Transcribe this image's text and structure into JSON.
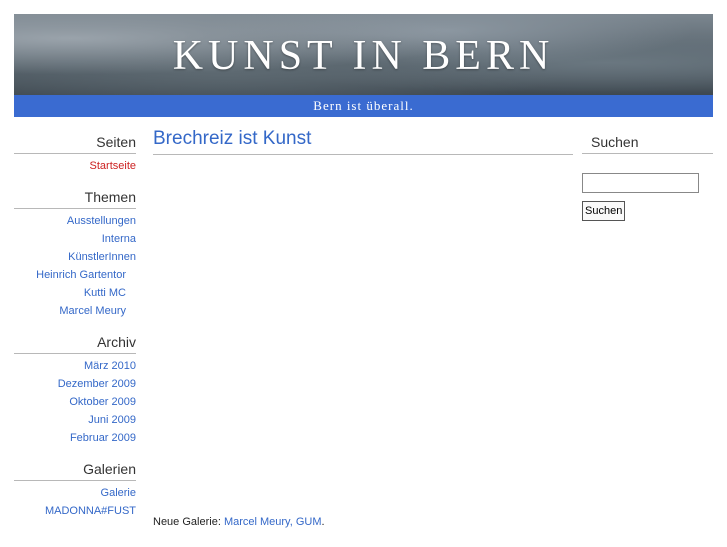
{
  "header": {
    "title": "KUNST IN BERN",
    "tagline": "Bern ist überall."
  },
  "sidebar_left": {
    "pages": {
      "title": "Seiten",
      "items": [
        {
          "label": "Startseite",
          "current": true
        }
      ]
    },
    "themes": {
      "title": "Themen",
      "items": [
        {
          "label": "Ausstellungen"
        },
        {
          "label": "Interna"
        },
        {
          "label": "KünstlerInnen"
        },
        {
          "label": "Heinrich Gartentor"
        },
        {
          "label": "Kutti MC"
        },
        {
          "label": "Marcel Meury"
        }
      ]
    },
    "archive": {
      "title": "Archiv",
      "items": [
        {
          "label": "März 2010"
        },
        {
          "label": "Dezember 2009"
        },
        {
          "label": "Oktober 2009"
        },
        {
          "label": "Juni 2009"
        },
        {
          "label": "Februar 2009"
        }
      ]
    },
    "galleries": {
      "title": "Galerien",
      "items": [
        {
          "label": "Galerie"
        },
        {
          "label": "MADONNA#FUST"
        }
      ]
    }
  },
  "main": {
    "post_title": "Brechreiz ist Kunst",
    "excerpt_prefix": "Neue Galerie: ",
    "excerpt_link": "Marcel Meury, GUM",
    "excerpt_suffix": "."
  },
  "sidebar_right": {
    "search_title": "Suchen",
    "search_value": "",
    "search_button": "Suchen"
  },
  "colors": {
    "link": "#3468c8",
    "current_link": "#cc2222",
    "tagline_bar": "#3a6bd1"
  }
}
